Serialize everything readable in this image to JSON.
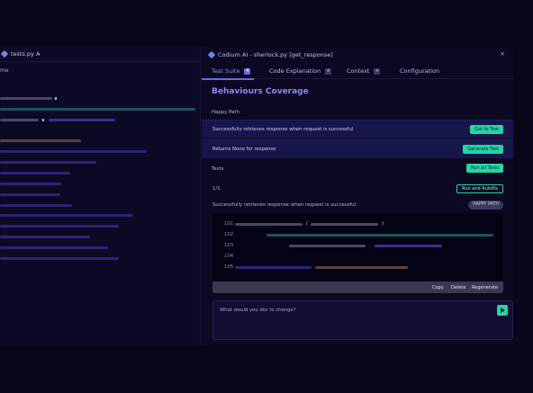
{
  "editor": {
    "tab_label": "tests.py A",
    "sub_label": "me",
    "bar_colors": {
      "gray": "#4a4862",
      "teal": "#19555a",
      "purple": "#3a2f8e",
      "brown": "#57453a",
      "light": "#d6d4ea"
    }
  },
  "panel": {
    "title": "Codium AI - sherlock.py [get_response]",
    "close_label": "×",
    "tabs": [
      {
        "label": "Test Suite",
        "count": "4"
      },
      {
        "label": "Code Explanation",
        "count": "+"
      },
      {
        "label": "Context",
        "count": "+"
      },
      {
        "label": "Configuration"
      }
    ],
    "section_title": "Behaviours Coverage",
    "happy_path_label": "Happy Path",
    "behaviours": [
      {
        "text": "Successfully retrieves response when request is successful",
        "button": "Got to Test"
      },
      {
        "text": "Returns None for response",
        "button": "Generate Test"
      }
    ],
    "tests_label": "Tests",
    "run_all_label": "Run all Tests",
    "test_count": "1/1",
    "run_autofix_label": "Run and Autofix",
    "test_name": "Successfully retrieves response when request is successful",
    "test_badge": "HAPPY PATH",
    "code": {
      "line_numbers": [
        "101",
        "102",
        "103",
        "104",
        "105"
      ],
      "paren_open": "(",
      "paren_close": ")",
      "dot": ".",
      "tools": [
        "Copy",
        "Delete",
        "Regenerate"
      ]
    },
    "chat_placeholder": "What would you like to change?"
  },
  "colors": {
    "accent": "#6b67e8",
    "mint": "#22d6a6",
    "band": "#17164a"
  }
}
